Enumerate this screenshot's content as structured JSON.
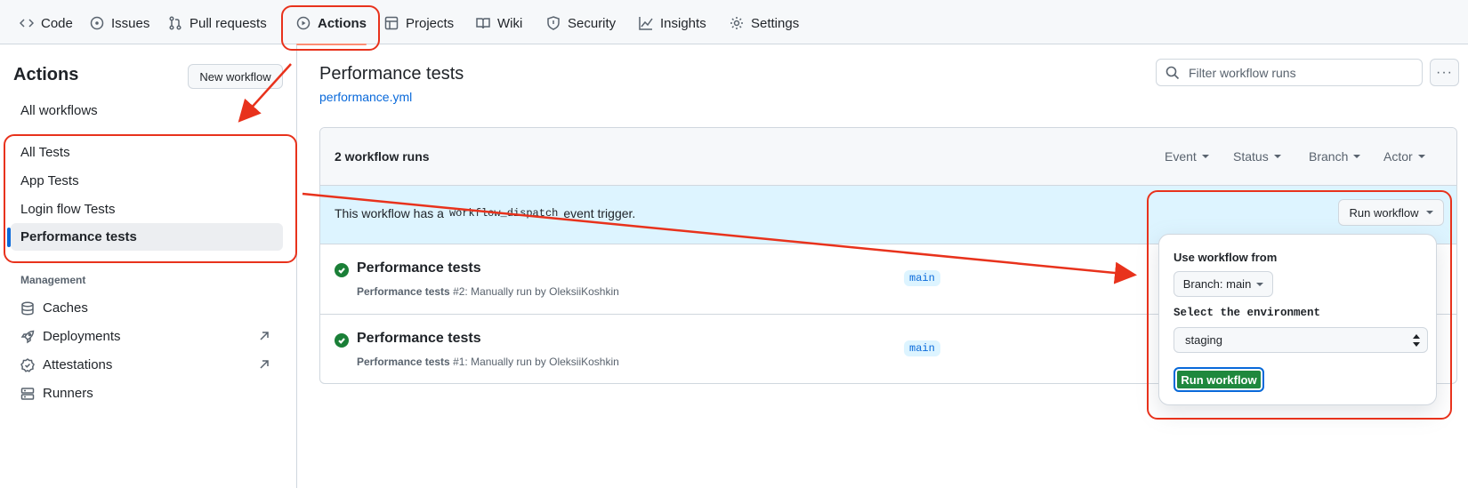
{
  "nav": {
    "tabs": [
      {
        "label": "Code",
        "icon": "code-icon"
      },
      {
        "label": "Issues",
        "icon": "issue-icon"
      },
      {
        "label": "Pull requests",
        "icon": "pull-request-icon"
      },
      {
        "label": "Actions",
        "icon": "play-icon",
        "active": true
      },
      {
        "label": "Projects",
        "icon": "table-icon"
      },
      {
        "label": "Wiki",
        "icon": "book-icon"
      },
      {
        "label": "Security",
        "icon": "shield-icon"
      },
      {
        "label": "Insights",
        "icon": "graph-icon"
      },
      {
        "label": "Settings",
        "icon": "gear-icon"
      }
    ]
  },
  "sidebar": {
    "title": "Actions",
    "new_workflow": "New workflow",
    "all_workflows": "All workflows",
    "workflows": [
      "All Tests",
      "App Tests",
      "Login flow Tests",
      "Performance tests"
    ],
    "selected_workflow": "Performance tests",
    "management_heading": "Management",
    "management": [
      {
        "label": "Caches",
        "icon": "database-icon"
      },
      {
        "label": "Deployments",
        "icon": "rocket-icon"
      },
      {
        "label": "Attestations",
        "icon": "verified-icon"
      },
      {
        "label": "Runners",
        "icon": "server-icon"
      }
    ]
  },
  "main": {
    "title": "Performance tests",
    "file_link": "performance.yml",
    "filter_placeholder": "Filter workflow runs",
    "more_label": "···",
    "runs_count": "2 workflow runs",
    "filters": [
      "Event",
      "Status",
      "Branch",
      "Actor"
    ],
    "dispatch_prefix": "This workflow has a",
    "dispatch_code": "workflow_dispatch",
    "dispatch_suffix": "event trigger.",
    "run_workflow_button": "Run workflow",
    "runs": [
      {
        "title": "Performance tests",
        "sub_bold": "Performance tests",
        "sub": "#2: Manually run by OleksiiKoshkin",
        "branch": "main",
        "status": "success"
      },
      {
        "title": "Performance tests",
        "sub_bold": "Performance tests",
        "sub": "#1: Manually run by OleksiiKoshkin",
        "branch": "main",
        "status": "success"
      }
    ]
  },
  "dropdown": {
    "use_from_label": "Use workflow from",
    "branch_button": "Branch: main",
    "env_label": "Select the environment",
    "env_value": "staging",
    "submit": "Run workflow"
  },
  "colors": {
    "accent": "#0969da",
    "success": "#1a7f37",
    "annotation": "#e8321c",
    "button_green": "#1f883d"
  }
}
